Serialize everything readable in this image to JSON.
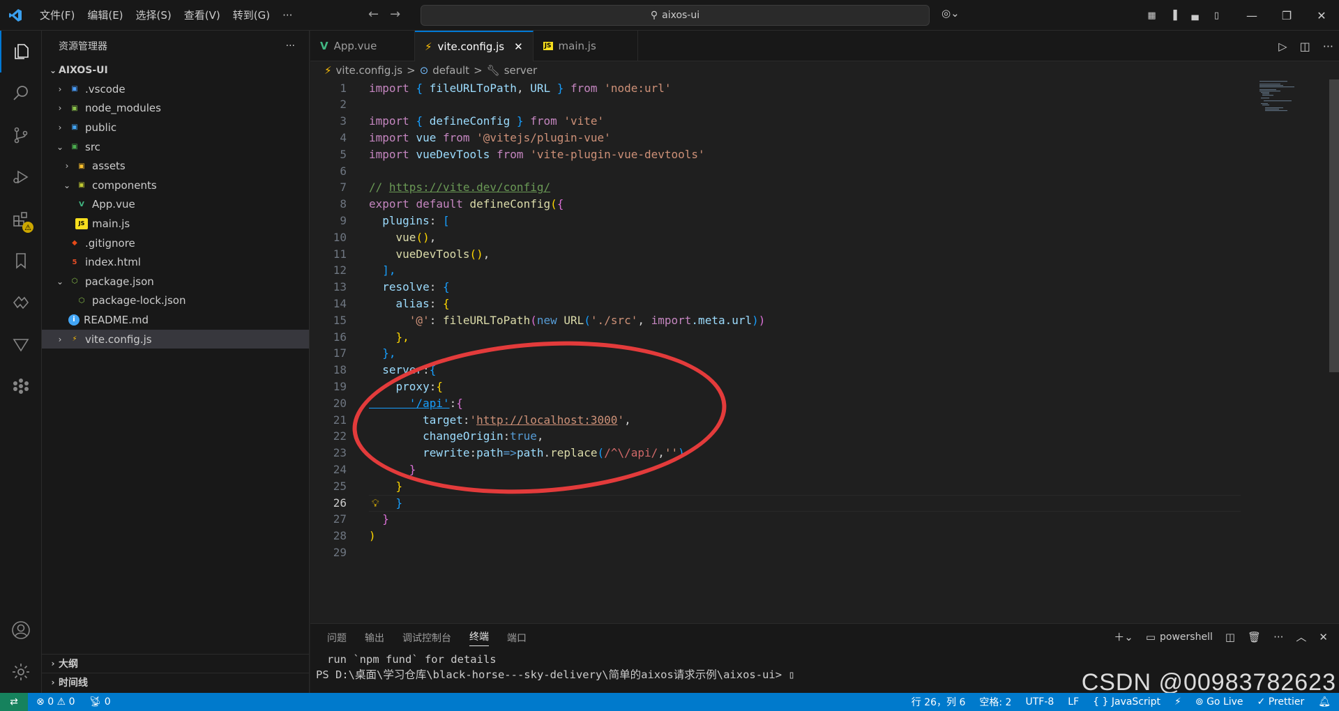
{
  "titlebar": {
    "menus": [
      "文件(F)",
      "编辑(E)",
      "选择(S)",
      "查看(V)",
      "转到(G)",
      "···"
    ],
    "search_text": "aixos-ui"
  },
  "sidebar": {
    "title": "资源管理器",
    "root": "AIXOS-UI",
    "items": [
      {
        "label": ".vscode",
        "depth": 1,
        "chev": "›",
        "icon": "vscode-folder-icon",
        "color": "#4a9eff"
      },
      {
        "label": "node_modules",
        "depth": 1,
        "chev": "›",
        "icon": "node-folder-icon",
        "color": "#8bc34a"
      },
      {
        "label": "public",
        "depth": 1,
        "chev": "›",
        "icon": "public-folder-icon",
        "color": "#42a5f5"
      },
      {
        "label": "src",
        "depth": 1,
        "chev": "⌄",
        "icon": "src-folder-icon",
        "color": "#4caf50"
      },
      {
        "label": "assets",
        "depth": 2,
        "chev": "›",
        "icon": "assets-folder-icon",
        "color": "#fbc02d"
      },
      {
        "label": "components",
        "depth": 2,
        "chev": "⌄",
        "icon": "components-folder-icon",
        "color": "#c0ca33"
      },
      {
        "label": "App.vue",
        "depth": 2,
        "chev": "",
        "icon": "vue-file-icon",
        "color": "#41b883"
      },
      {
        "label": "main.js",
        "depth": 2,
        "chev": "",
        "icon": "js-file-icon",
        "color": "#f7df1e"
      },
      {
        "label": ".gitignore",
        "depth": 1,
        "chev": "",
        "icon": "git-file-icon",
        "color": "#e64a19"
      },
      {
        "label": "index.html",
        "depth": 1,
        "chev": "",
        "icon": "html-file-icon",
        "color": "#e44d26"
      },
      {
        "label": "package.json",
        "depth": 1,
        "chev": "⌄",
        "icon": "npm-file-icon",
        "color": "#8bc34a"
      },
      {
        "label": "package-lock.json",
        "depth": 2,
        "chev": "",
        "icon": "npm-lock-file-icon",
        "color": "#8bc34a"
      },
      {
        "label": "README.md",
        "depth": 1,
        "chev": "",
        "icon": "info-file-icon",
        "color": "#42a5f5"
      },
      {
        "label": "vite.config.js",
        "depth": 1,
        "chev": "›",
        "icon": "vite-file-icon",
        "color": "#ffc107",
        "selected": true
      }
    ],
    "outline": "大纲",
    "timeline": "时间线"
  },
  "tabs": [
    {
      "label": "App.vue",
      "icon": "vue-file-icon",
      "active": false
    },
    {
      "label": "vite.config.js",
      "icon": "vite-file-icon",
      "active": true
    },
    {
      "label": "main.js",
      "icon": "js-file-icon",
      "active": false
    }
  ],
  "breadcrumb": {
    "file": "vite.config.js",
    "sep": ">",
    "seg1": "default",
    "seg2": "server"
  },
  "editor": {
    "current_line": 26,
    "lines": [
      [
        [
          "import ",
          "kw2"
        ],
        [
          "{ ",
          "b3"
        ],
        [
          "fileURLToPath",
          "var"
        ],
        [
          ", ",
          "pl"
        ],
        [
          "URL",
          "var"
        ],
        [
          " } ",
          "b3"
        ],
        [
          "from ",
          "kw2"
        ],
        [
          "'node:url'",
          "str"
        ]
      ],
      [],
      [
        [
          "import ",
          "kw2"
        ],
        [
          "{ ",
          "b3"
        ],
        [
          "defineConfig",
          "var"
        ],
        [
          " } ",
          "b3"
        ],
        [
          "from ",
          "kw2"
        ],
        [
          "'vite'",
          "str"
        ]
      ],
      [
        [
          "import ",
          "kw2"
        ],
        [
          "vue ",
          "var"
        ],
        [
          "from ",
          "kw2"
        ],
        [
          "'@vitejs/plugin-vue'",
          "str"
        ]
      ],
      [
        [
          "import ",
          "kw2"
        ],
        [
          "vueDevTools ",
          "var"
        ],
        [
          "from ",
          "kw2"
        ],
        [
          "'vite-plugin-vue-devtools'",
          "str"
        ]
      ],
      [],
      [
        [
          "// ",
          "cm"
        ],
        [
          "https://vite.dev/config/",
          "cm url"
        ]
      ],
      [
        [
          "export ",
          "kw2"
        ],
        [
          "default ",
          "kw2"
        ],
        [
          "defineConfig",
          "fn"
        ],
        [
          "(",
          "b1"
        ],
        [
          "{",
          "b2"
        ]
      ],
      [
        [
          "  plugins",
          "var"
        ],
        [
          ": ",
          "pl"
        ],
        [
          "[",
          "b3"
        ]
      ],
      [
        [
          "    vue",
          "fn"
        ],
        [
          "()",
          "b1"
        ],
        [
          ",",
          "pl"
        ]
      ],
      [
        [
          "    vueDevTools",
          "fn"
        ],
        [
          "()",
          "b1"
        ],
        [
          ",",
          "pl"
        ]
      ],
      [
        [
          "  ],",
          "b3"
        ]
      ],
      [
        [
          "  resolve",
          "var"
        ],
        [
          ": ",
          "pl"
        ],
        [
          "{",
          "b3"
        ]
      ],
      [
        [
          "    alias",
          "var"
        ],
        [
          ": ",
          "pl"
        ],
        [
          "{",
          "b1"
        ]
      ],
      [
        [
          "      '@'",
          "str"
        ],
        [
          ": ",
          "pl"
        ],
        [
          "fileURLToPath",
          "fn"
        ],
        [
          "(",
          "b2"
        ],
        [
          "new ",
          "kw"
        ],
        [
          "URL",
          "fn"
        ],
        [
          "(",
          "b3"
        ],
        [
          "'./src'",
          "str"
        ],
        [
          ", ",
          "pl"
        ],
        [
          "import",
          "kw2"
        ],
        [
          ".meta.url",
          "var"
        ],
        [
          ")",
          "b3"
        ],
        [
          ")",
          "b2"
        ]
      ],
      [
        [
          "    },",
          "b1"
        ]
      ],
      [
        [
          "  },",
          "b3"
        ]
      ],
      [
        [
          "  server",
          "var"
        ],
        [
          ":",
          "pl"
        ],
        [
          "{",
          "b3"
        ]
      ],
      [
        [
          "    proxy",
          "var"
        ],
        [
          ":",
          "pl"
        ],
        [
          "{",
          "b1"
        ]
      ],
      [
        [
          "      '/api'",
          "str url b3"
        ],
        [
          ":",
          "pl"
        ],
        [
          "{",
          "b2"
        ]
      ],
      [
        [
          "        target",
          "var"
        ],
        [
          ":",
          "pl"
        ],
        [
          "'",
          "str"
        ],
        [
          "http://localhost:3000",
          "str url"
        ],
        [
          "'",
          "str"
        ],
        [
          ",",
          "pl"
        ]
      ],
      [
        [
          "        changeOrigin",
          "var"
        ],
        [
          ":",
          "pl"
        ],
        [
          "true",
          "kw"
        ],
        [
          ",",
          "pl"
        ]
      ],
      [
        [
          "        rewrite",
          "var"
        ],
        [
          ":",
          "pl"
        ],
        [
          "path",
          "var"
        ],
        [
          "=>",
          "kw"
        ],
        [
          "path",
          "var"
        ],
        [
          ".",
          "pl"
        ],
        [
          "replace",
          "fn"
        ],
        [
          "(",
          "b3"
        ],
        [
          "/^\\/api/",
          "rx"
        ],
        [
          ",",
          "pl"
        ],
        [
          "''",
          "str"
        ],
        [
          ")",
          "b3"
        ]
      ],
      [
        [
          "      }",
          "b2"
        ]
      ],
      [
        [
          "    }",
          "b1"
        ]
      ],
      [
        [
          "    }",
          "b3"
        ]
      ],
      [
        [
          "  }",
          "b2"
        ]
      ],
      [
        [
          ")",
          "b1"
        ]
      ],
      []
    ]
  },
  "panel": {
    "tabs": [
      "问题",
      "输出",
      "调试控制台",
      "终端",
      "端口"
    ],
    "active_tab": "终端",
    "shell": "powershell",
    "terminal_lines": [
      "  run `npm fund` for details",
      "PS D:\\桌面\\学习仓库\\black-horse---sky-delivery\\简单的aixos请求示例\\aixos-ui> ▯"
    ]
  },
  "status": {
    "errors": "0",
    "warnings": "0",
    "ports": "0",
    "position": "行 26，列 6",
    "spaces": "空格: 2",
    "encoding": "UTF-8",
    "eol": "LF",
    "language": "{ } JavaScript",
    "golive": "Go Live",
    "prettier": "✓ Prettier"
  },
  "watermark": "CSDN @00983782623"
}
